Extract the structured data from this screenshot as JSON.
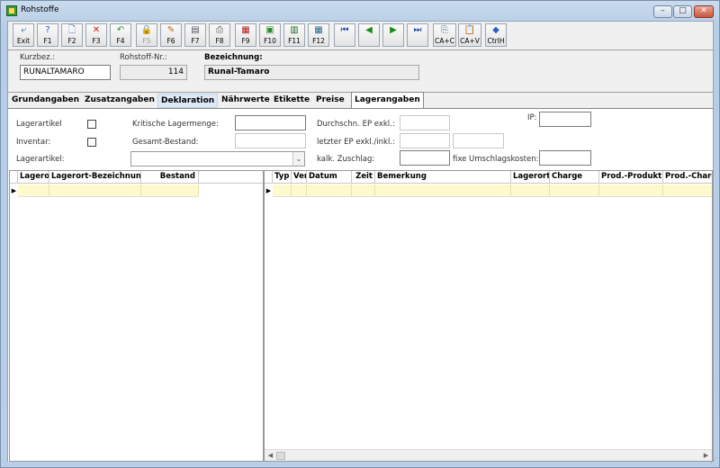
{
  "window": {
    "title": "Rohstoffe"
  },
  "toolbar": {
    "buttons": [
      {
        "label": "Exit",
        "icon": "exit-icon",
        "glyph": "⤶"
      },
      {
        "label": "F1",
        "icon": "help-icon",
        "glyph": "?"
      },
      {
        "label": "F2",
        "icon": "new-document-icon",
        "glyph": "🗋"
      },
      {
        "label": "F3",
        "icon": "delete-icon",
        "glyph": "✕"
      },
      {
        "label": "F4",
        "icon": "undo-icon",
        "glyph": "↶"
      },
      {
        "label": "F5",
        "icon": "lock-icon",
        "glyph": "🔒"
      },
      {
        "label": "F6",
        "icon": "edit-icon",
        "glyph": "✎"
      },
      {
        "label": "F7",
        "icon": "folder-icon",
        "glyph": "▤"
      },
      {
        "label": "F8",
        "icon": "print-icon",
        "glyph": "⎙"
      },
      {
        "label": "F9",
        "icon": "open-icon",
        "glyph": "▦"
      },
      {
        "label": "F10",
        "icon": "save-icon",
        "glyph": "▣"
      },
      {
        "label": "F11",
        "icon": "table-icon",
        "glyph": "▥"
      },
      {
        "label": "F12",
        "icon": "calculator-icon",
        "glyph": "▦"
      },
      {
        "label": "",
        "icon": "first-record-icon",
        "glyph": "⏮"
      },
      {
        "label": "",
        "icon": "previous-record-icon",
        "glyph": "◀"
      },
      {
        "label": "",
        "icon": "next-record-icon",
        "glyph": "▶"
      },
      {
        "label": "",
        "icon": "last-record-icon",
        "glyph": "⏭"
      },
      {
        "label": "CA+C",
        "icon": "copy-icon",
        "glyph": "⎘"
      },
      {
        "label": "CA+V",
        "icon": "paste-icon",
        "glyph": "📋"
      },
      {
        "label": "CtrlH",
        "icon": "diamond-icon",
        "glyph": "◆"
      }
    ]
  },
  "header": {
    "kurzbez_label": "Kurzbez.:",
    "kurzbez_value": "RUNALTAMARO",
    "nr_label": "Rohstoff-Nr.:",
    "nr_value": "114",
    "bez_label": "Bezeichnung:",
    "bez_value": "Runal-Tamaro"
  },
  "tabs": [
    "Grundangaben",
    "Zusatzangaben",
    "Deklaration",
    "Nährwerte",
    "Etikette",
    "Preise",
    "Lagerangaben"
  ],
  "form": {
    "lagerartikel": "Lagerartikel",
    "inventar": "Inventar:",
    "lagerartikel_combo": "Lagerartikel:",
    "kritische": "Kritische Lagermenge:",
    "gesamt": "Gesamt-Bestand:",
    "durchschn": "Durchschn. EP exkl.:",
    "letzter": "letzter EP exkl./inkl.:",
    "kalk": "kalk. Zuschlag:",
    "fixe": "fixe Umschlagskosten:",
    "ip": "IP:"
  },
  "left_grid": {
    "columns": [
      "Lagerort",
      "Lagerort-Bezeichnung",
      "Bestand"
    ]
  },
  "right_grid": {
    "columns": [
      "Typ",
      "Verk",
      "Datum",
      "Zeit",
      "Bemerkung",
      "Lagerort",
      "Charge",
      "Prod.-Produkt",
      "Prod.-Charge"
    ]
  }
}
